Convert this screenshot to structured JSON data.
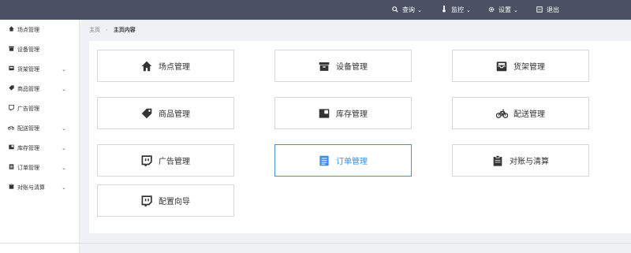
{
  "topnav": {
    "search": "查询",
    "monitor": "监控",
    "settings": "设置",
    "logout": "退出"
  },
  "sidebar": {
    "items": [
      {
        "label": "场点管理",
        "icon": "home-icon",
        "has_submenu": false
      },
      {
        "label": "设备管理",
        "icon": "archive-icon",
        "has_submenu": false
      },
      {
        "label": "货架管理",
        "icon": "inbox-icon",
        "has_submenu": true
      },
      {
        "label": "商品管理",
        "icon": "tag-icon",
        "has_submenu": true
      },
      {
        "label": "广告管理",
        "icon": "twitch-icon",
        "has_submenu": false
      },
      {
        "label": "配送管理",
        "icon": "bicycle-icon",
        "has_submenu": true
      },
      {
        "label": "库存管理",
        "icon": "book-icon",
        "has_submenu": true
      },
      {
        "label": "订单管理",
        "icon": "list-icon",
        "has_submenu": true
      },
      {
        "label": "对账与清算",
        "icon": "clipboard-icon",
        "has_submenu": true
      }
    ]
  },
  "breadcrumb": {
    "home": "主页",
    "current": "主页内容"
  },
  "tiles": [
    {
      "label": "场点管理",
      "icon": "home-icon",
      "active": false
    },
    {
      "label": "设备管理",
      "icon": "archive-icon",
      "active": false
    },
    {
      "label": "货架管理",
      "icon": "inbox-icon",
      "active": false
    },
    {
      "label": "商品管理",
      "icon": "tag-icon",
      "active": false
    },
    {
      "label": "库存管理",
      "icon": "book-icon",
      "active": false
    },
    {
      "label": "配送管理",
      "icon": "bicycle-icon",
      "active": false
    },
    {
      "label": "广告管理",
      "icon": "twitch-icon",
      "active": false
    },
    {
      "label": "订单管理",
      "icon": "list-icon",
      "active": true
    },
    {
      "label": "对账与清算",
      "icon": "clipboard-icon",
      "active": false
    },
    {
      "label": "配置向导",
      "icon": "twitch-icon",
      "active": false
    }
  ],
  "colors": {
    "topbar": "#4b5162",
    "active_accent": "#3c8dde"
  }
}
